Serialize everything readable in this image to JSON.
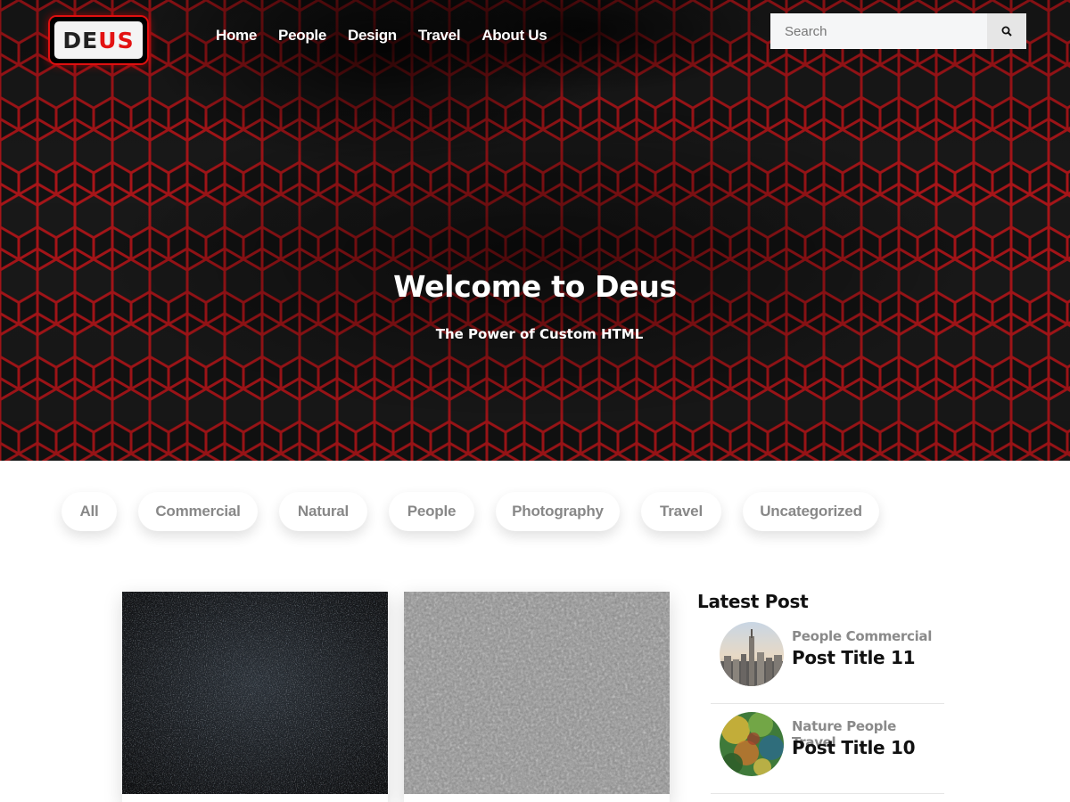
{
  "logo": {
    "part1": "DE",
    "part2": "US"
  },
  "nav": {
    "items": [
      "Home",
      "People",
      "Design",
      "Travel",
      "About Us"
    ]
  },
  "search": {
    "placeholder": "Search",
    "button_icon": "search-icon"
  },
  "hero": {
    "title": "Welcome to Deus",
    "subtitle": "The Power of Custom HTML"
  },
  "filters": [
    "All",
    "Commercial",
    "Natural",
    "People",
    "Photography",
    "Travel",
    "Uncategorized"
  ],
  "sidebar": {
    "title": "Latest Post",
    "posts": [
      {
        "categories": "People Commercial",
        "title": "Post Title 11"
      },
      {
        "categories": "Nature People Travel",
        "title": "Post Title 10"
      }
    ]
  },
  "colors": {
    "accent": "#e31212",
    "hex_glow": "#c2191b",
    "hero_bg": "#141414",
    "pill_text": "#888888"
  }
}
